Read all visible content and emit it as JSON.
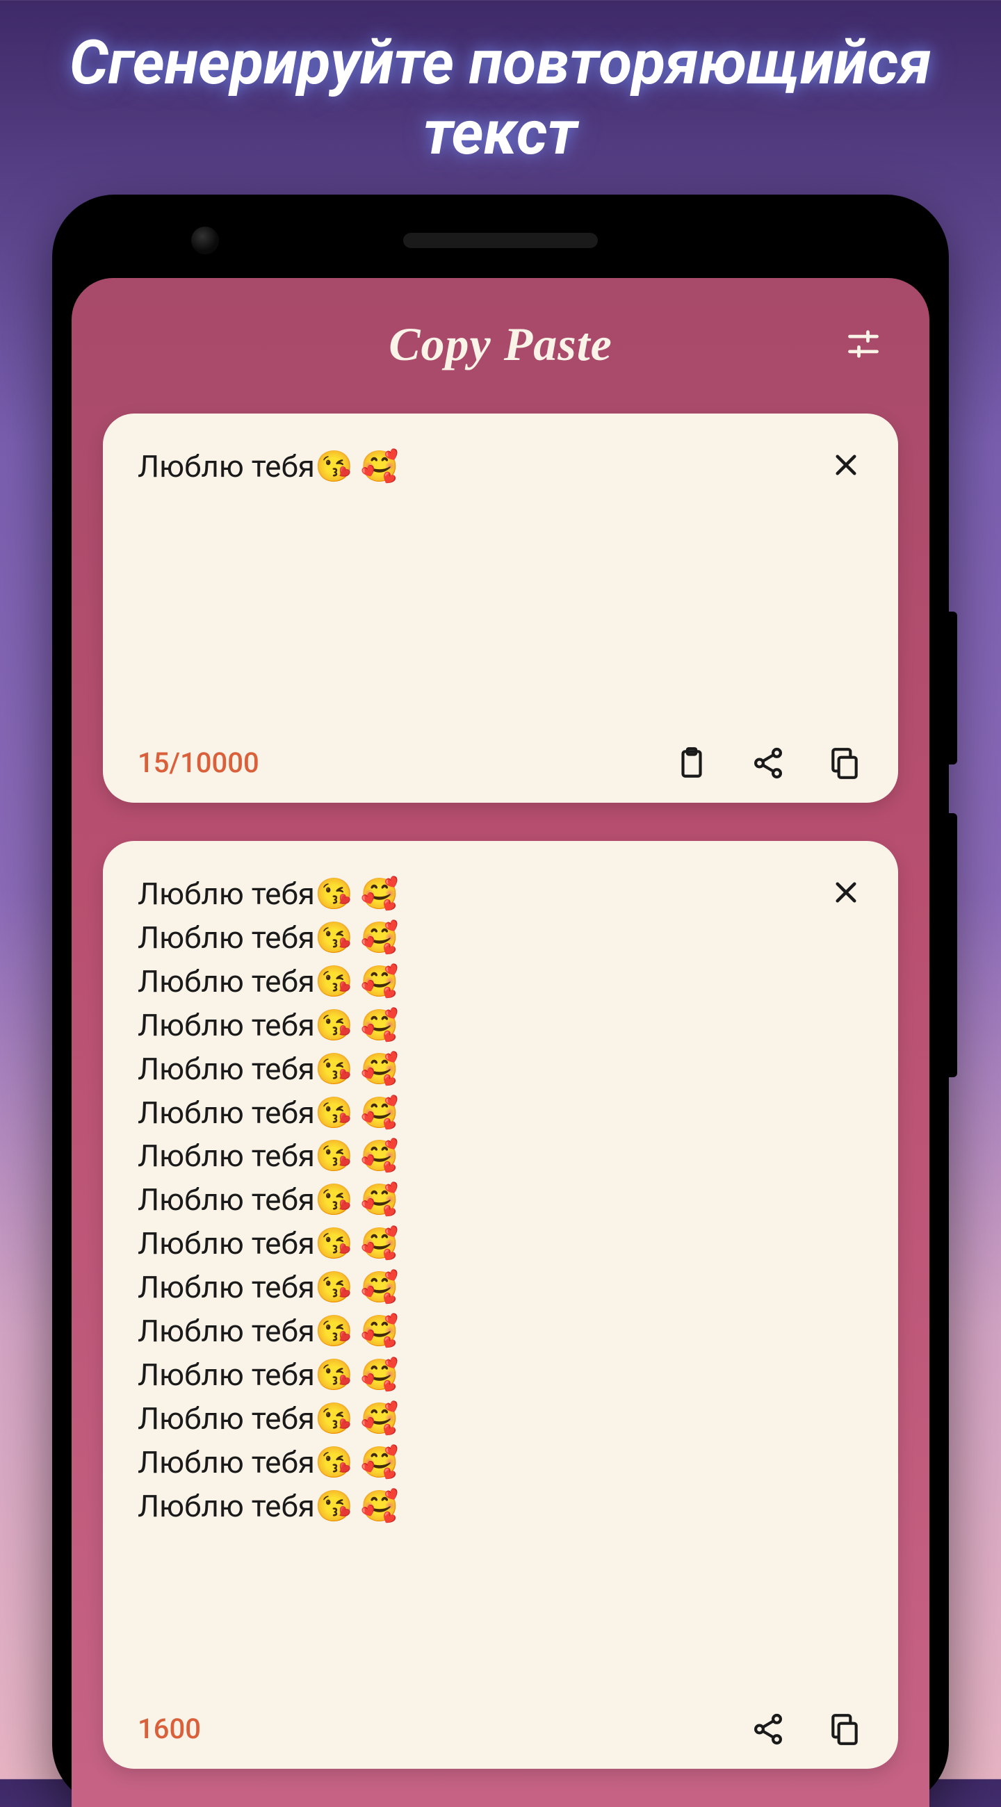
{
  "promo": {
    "headline": "Сгенерируйте повторяющийся текст"
  },
  "header": {
    "title": "Copy Paste"
  },
  "input_card": {
    "text": "Люблю тебя😘 🥰",
    "counter": "15/10000"
  },
  "output_card": {
    "line": "Люблю тебя😘 🥰",
    "repeat_visible": 15,
    "counter": "1600"
  },
  "colors": {
    "accent": "#d9603a",
    "card_bg": "#faf3e8",
    "screen_grad_top": "#a84a6a",
    "screen_grad_bot": "#c66385"
  }
}
